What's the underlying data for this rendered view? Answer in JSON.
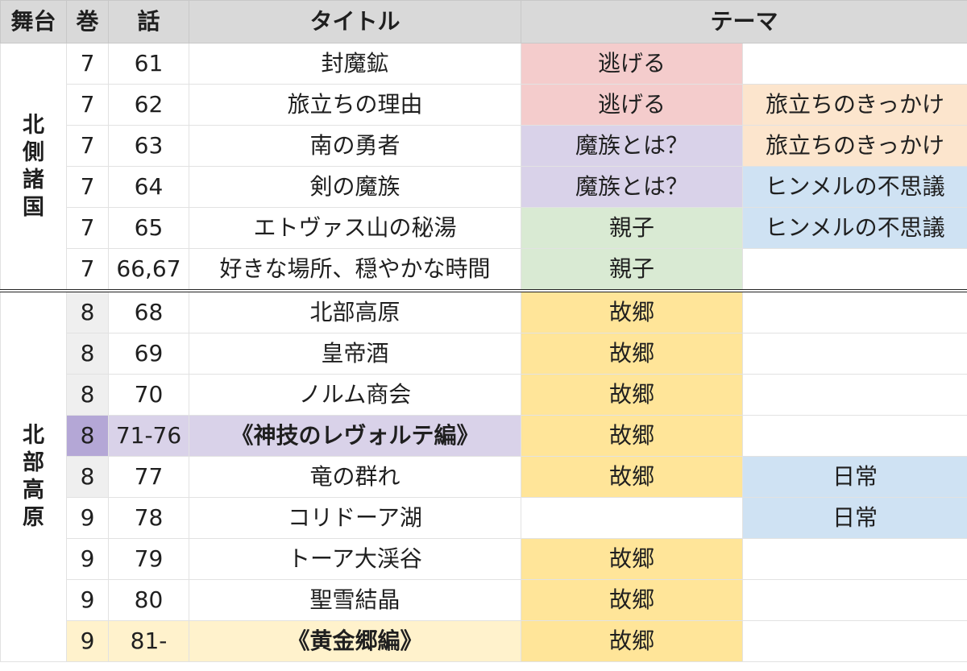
{
  "header": {
    "region": "舞台",
    "volume": "巻",
    "episode": "話",
    "title": "タイトル",
    "theme": "テーマ"
  },
  "regions": [
    {
      "name": "北側諸国",
      "chars": [
        "北",
        "側",
        "諸",
        "国"
      ],
      "rowspan": 6
    },
    {
      "name": "北部高原",
      "chars": [
        "北",
        "部",
        "高",
        "原"
      ],
      "rowspan": 9
    }
  ],
  "colors": {
    "pink": "#f4cccc",
    "purple": "#d9d2e9",
    "green": "#d9ead3",
    "yellow": "#ffe599",
    "orange": "#fce5cd",
    "blue": "#cfe2f3",
    "lightyellow": "#fff2cc",
    "volume_grey": "#efefef",
    "volume_purple": "#b4a7d6"
  },
  "rows": [
    {
      "vol": "7",
      "ep": "61",
      "title": "封魔鉱",
      "t1": "逃げる",
      "c1": "pink",
      "t2": "",
      "c2": ""
    },
    {
      "vol": "7",
      "ep": "62",
      "title": "旅立ちの理由",
      "t1": "逃げる",
      "c1": "pink",
      "t2": "旅立ちのきっかけ",
      "c2": "orange"
    },
    {
      "vol": "7",
      "ep": "63",
      "title": "南の勇者",
      "t1": "魔族とは？",
      "c1": "purple",
      "t2": "旅立ちのきっかけ",
      "c2": "orange"
    },
    {
      "vol": "7",
      "ep": "64",
      "title": "剣の魔族",
      "t1": "魔族とは？",
      "c1": "purple",
      "t2": "ヒンメルの不思議",
      "c2": "blue"
    },
    {
      "vol": "7",
      "ep": "65",
      "title": "エトヴァス山の秘湯",
      "t1": "親子",
      "c1": "green",
      "t2": "ヒンメルの不思議",
      "c2": "blue"
    },
    {
      "vol": "7",
      "ep": "66,67",
      "title": "好きな場所、穏やかな時間",
      "t1": "親子",
      "c1": "green",
      "t2": "",
      "c2": "",
      "sep": true
    },
    {
      "vol": "8",
      "ep": "68",
      "title": "北部高原",
      "t1": "故郷",
      "c1": "yellow",
      "t2": "",
      "c2": "",
      "volc": "volume_grey"
    },
    {
      "vol": "8",
      "ep": "69",
      "title": "皇帝酒",
      "t1": "故郷",
      "c1": "yellow",
      "t2": "",
      "c2": "",
      "volc": "volume_grey"
    },
    {
      "vol": "8",
      "ep": "70",
      "title": "ノルム商会",
      "t1": "故郷",
      "c1": "yellow",
      "t2": "",
      "c2": "",
      "volc": "volume_grey"
    },
    {
      "vol": "8",
      "ep": "71-76",
      "title": "《神技のレヴォルテ編》",
      "t1": "故郷",
      "c1": "yellow",
      "t2": "",
      "c2": "",
      "volc": "volume_purple",
      "rowc": "purple",
      "bold": true
    },
    {
      "vol": "8",
      "ep": "77",
      "title": "竜の群れ",
      "t1": "故郷",
      "c1": "yellow",
      "t2": "日常",
      "c2": "blue",
      "volc": "volume_grey"
    },
    {
      "vol": "9",
      "ep": "78",
      "title": "コリドーア湖",
      "t1": "",
      "c1": "",
      "t2": "日常",
      "c2": "blue"
    },
    {
      "vol": "9",
      "ep": "79",
      "title": "トーア大渓谷",
      "t1": "故郷",
      "c1": "yellow",
      "t2": "",
      "c2": ""
    },
    {
      "vol": "9",
      "ep": "80",
      "title": "聖雪結晶",
      "t1": "故郷",
      "c1": "yellow",
      "t2": "",
      "c2": ""
    },
    {
      "vol": "9",
      "ep": "81-",
      "title": "《黄金郷編》",
      "t1": "故郷",
      "c1": "yellow",
      "t2": "",
      "c2": "",
      "volc": "lightyellow",
      "rowc": "lightyellow",
      "bold": true
    }
  ]
}
